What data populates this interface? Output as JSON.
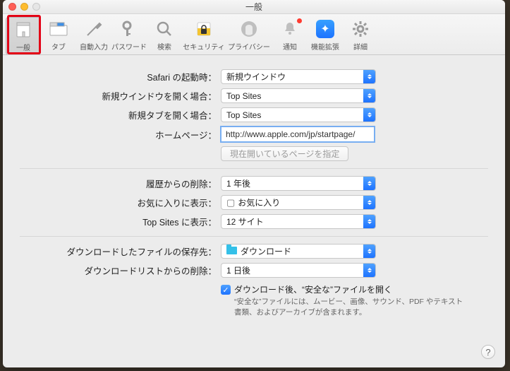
{
  "window": {
    "title": "一般"
  },
  "toolbar": {
    "items": [
      {
        "label": "一般"
      },
      {
        "label": "タブ"
      },
      {
        "label": "自動入力"
      },
      {
        "label": "パスワード"
      },
      {
        "label": "検索"
      },
      {
        "label": "セキュリティ"
      },
      {
        "label": "プライバシー"
      },
      {
        "label": "通知"
      },
      {
        "label": "機能拡張"
      },
      {
        "label": "詳細"
      }
    ]
  },
  "form": {
    "launch": {
      "label": "Safari の起動時",
      "value": "新規ウインドウ"
    },
    "newWindow": {
      "label": "新規ウインドウを開く場合",
      "value": "Top Sites"
    },
    "newTab": {
      "label": "新規タブを開く場合",
      "value": "Top Sites"
    },
    "homepage": {
      "label": "ホームページ",
      "value": "http://www.apple.com/jp/startpage/"
    },
    "setCurrent": {
      "label": "現在開いているページを指定"
    },
    "removeHistory": {
      "label": "履歴からの削除",
      "value": "1 年後"
    },
    "favorites": {
      "label": "お気に入りに表示",
      "value": "お気に入り"
    },
    "topSites": {
      "label": "Top Sites に表示",
      "value": "12 サイト"
    },
    "downloadLoc": {
      "label": "ダウンロードしたファイルの保存先",
      "value": "ダウンロード"
    },
    "downloadClear": {
      "label": "ダウンロードリストからの削除",
      "value": "1 日後"
    },
    "safeFiles": {
      "label": "ダウンロード後、“安全な”ファイルを開く",
      "note": "“安全な”ファイルには、ムービー、画像、サウンド、PDF やテキスト書類、およびアーカイブが含まれます。"
    }
  }
}
